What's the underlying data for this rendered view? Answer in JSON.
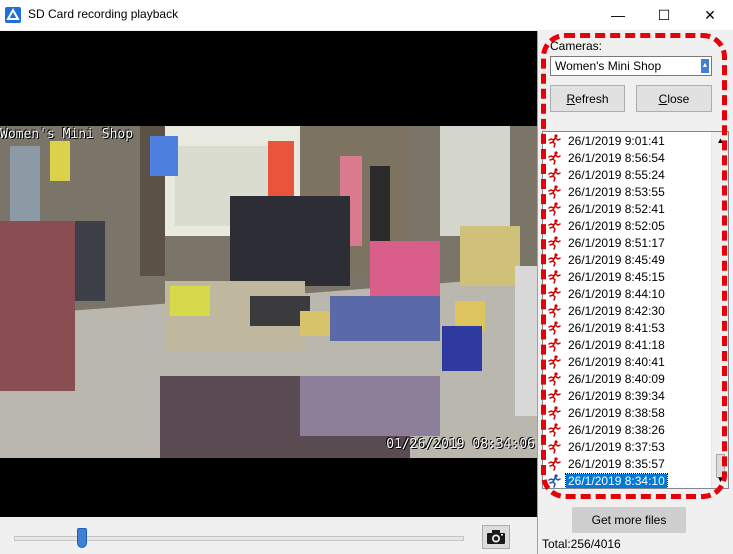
{
  "window": {
    "title": "SD Card recording playback",
    "minimize_glyph": "—",
    "maximize_glyph": "☐",
    "close_glyph": "✕"
  },
  "video": {
    "osd_name": "Women's Mini Shop",
    "osd_time": "01/26/2019 08:34:06",
    "playback_position": 0.15
  },
  "sidebar": {
    "cameras_label": "Cameras:",
    "camera_selected": "Women's Mini Shop",
    "refresh_label": "Refresh",
    "close_label": "Close",
    "recordings": [
      "26/1/2019 9:01:41",
      "26/1/2019 8:56:54",
      "26/1/2019 8:55:24",
      "26/1/2019 8:53:55",
      "26/1/2019 8:52:41",
      "26/1/2019 8:52:05",
      "26/1/2019 8:51:17",
      "26/1/2019 8:45:49",
      "26/1/2019 8:45:15",
      "26/1/2019 8:44:10",
      "26/1/2019 8:42:30",
      "26/1/2019 8:41:53",
      "26/1/2019 8:41:18",
      "26/1/2019 8:40:41",
      "26/1/2019 8:40:09",
      "26/1/2019 8:39:34",
      "26/1/2019 8:38:58",
      "26/1/2019 8:38:26",
      "26/1/2019 8:37:53",
      "26/1/2019 8:35:57",
      "26/1/2019 8:34:10"
    ],
    "selected_index": 20,
    "get_more_label": "Get more files",
    "total_text": "Total:256/4016"
  },
  "colors": {
    "accent": "#0078d7",
    "highlight_ring": "#e5000a",
    "motion_icon": "#d40000"
  },
  "icons": {
    "app": "app-icon",
    "motion": "running-person-icon",
    "snapshot": "camera-icon"
  }
}
